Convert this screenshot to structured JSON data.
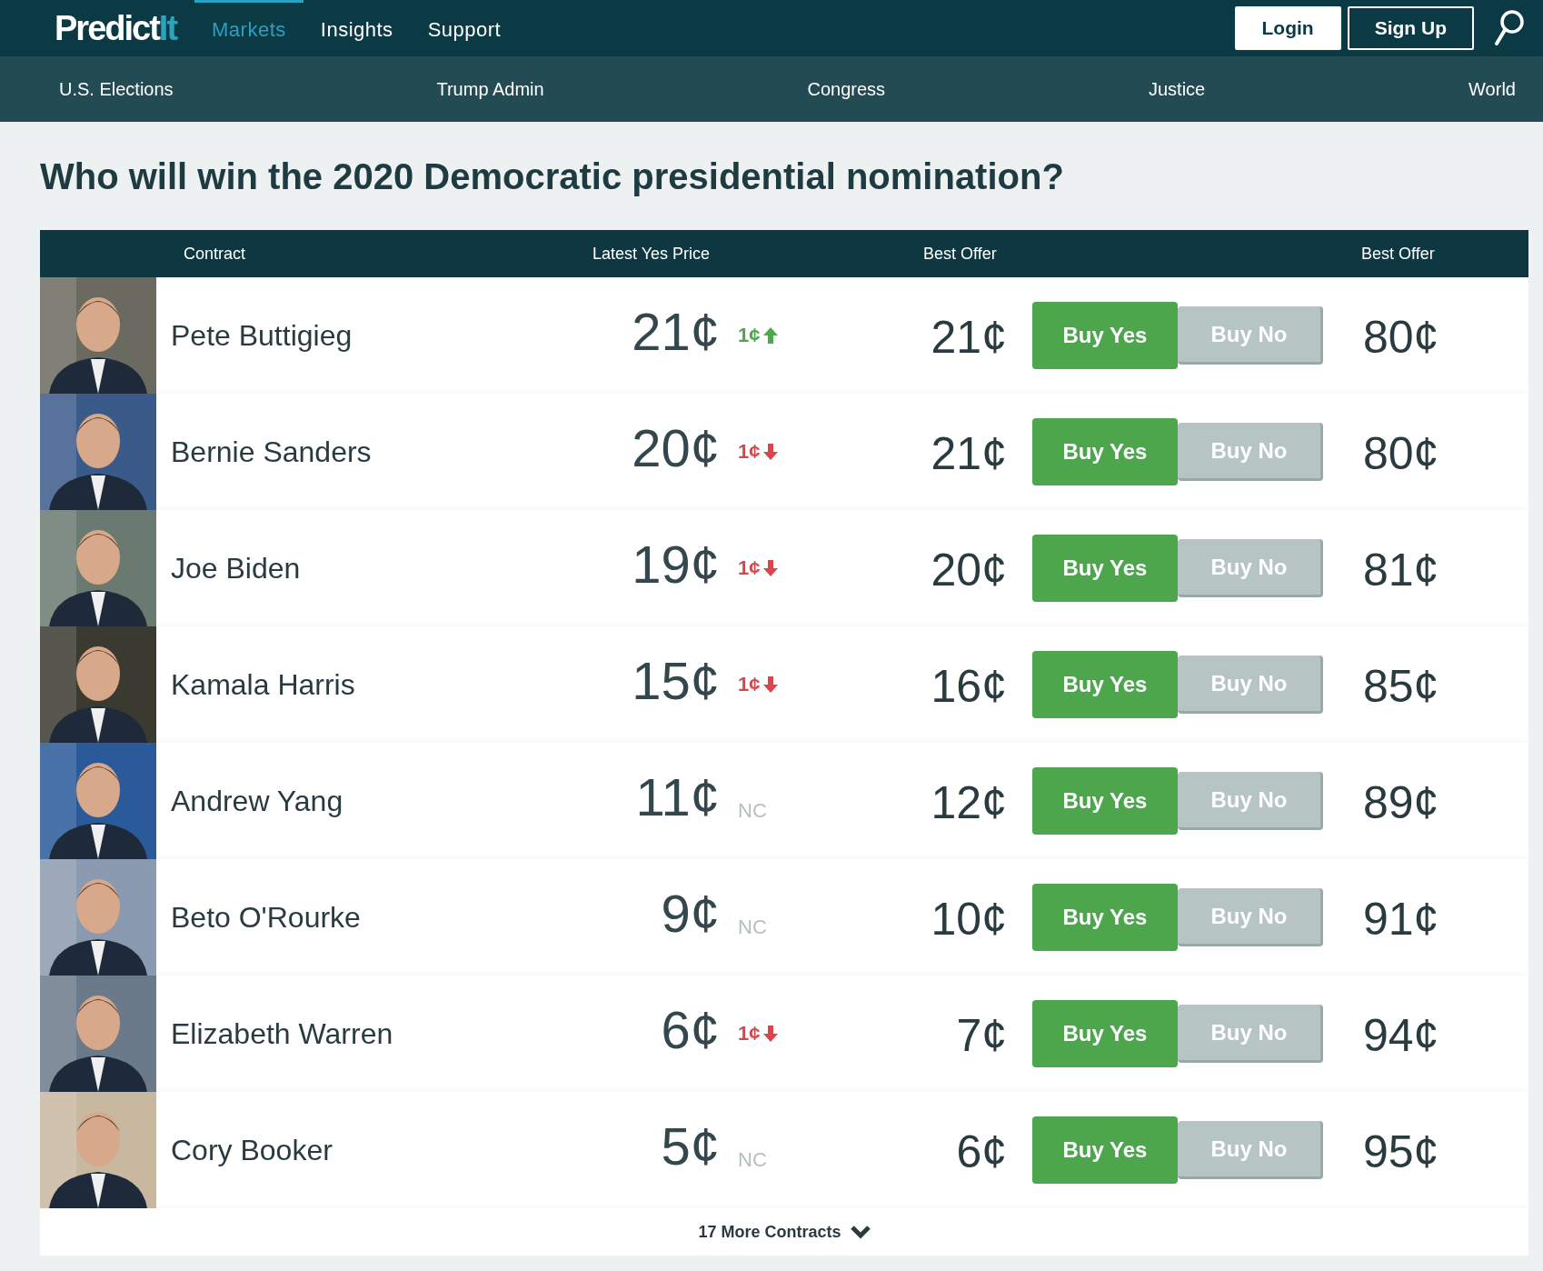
{
  "logo": {
    "main": "Predict",
    "accent": "It"
  },
  "nav": [
    {
      "label": "Markets",
      "selected": true
    },
    {
      "label": "Insights",
      "selected": false
    },
    {
      "label": "Support",
      "selected": false
    }
  ],
  "auth_buttons": [
    "Login",
    "Sign Up"
  ],
  "categories": [
    "U.S. Elections",
    "Trump Admin",
    "Congress",
    "Justice",
    "World"
  ],
  "title": "Who will win the 2020 Democratic presidential nomination?",
  "table": {
    "columns": [
      "Contract",
      "Latest Yes Price",
      "Best Offer",
      "Best Offer"
    ],
    "rows": [
      {
        "name": "Pete Buttigieg",
        "price": "21¢",
        "change": "1¢",
        "kind": "up",
        "yes_offer": "21¢",
        "buy_yes": "Buy Yes",
        "buy_no": "Buy No",
        "no_offer": "80¢"
      },
      {
        "name": "Bernie Sanders",
        "price": "20¢",
        "change": "1¢",
        "kind": "down",
        "yes_offer": "21¢",
        "buy_yes": "Buy Yes",
        "buy_no": "Buy No",
        "no_offer": "80¢"
      },
      {
        "name": "Joe Biden",
        "price": "19¢",
        "change": "1¢",
        "kind": "down",
        "yes_offer": "20¢",
        "buy_yes": "Buy Yes",
        "buy_no": "Buy No",
        "no_offer": "81¢"
      },
      {
        "name": "Kamala Harris",
        "price": "15¢",
        "change": "1¢",
        "kind": "down",
        "yes_offer": "16¢",
        "buy_yes": "Buy Yes",
        "buy_no": "Buy No",
        "no_offer": "85¢"
      },
      {
        "name": "Andrew Yang",
        "price": "11¢",
        "change": "NC",
        "kind": "unchanged",
        "yes_offer": "12¢",
        "buy_yes": "Buy Yes",
        "buy_no": "Buy No",
        "no_offer": "89¢"
      },
      {
        "name": "Beto O'Rourke",
        "price": "9¢",
        "change": "NC",
        "kind": "unchanged",
        "yes_offer": "10¢",
        "buy_yes": "Buy Yes",
        "buy_no": "Buy No",
        "no_offer": "91¢"
      },
      {
        "name": "Elizabeth Warren",
        "price": "6¢",
        "change": "1¢",
        "kind": "down",
        "yes_offer": "7¢",
        "buy_yes": "Buy Yes",
        "buy_no": "Buy No",
        "no_offer": "94¢"
      },
      {
        "name": "Cory Booker",
        "price": "5¢",
        "change": "NC",
        "kind": "unchanged",
        "yes_offer": "6¢",
        "buy_yes": "Buy Yes",
        "buy_no": "Buy No",
        "no_offer": "95¢"
      }
    ],
    "more": "17 More Contracts"
  }
}
